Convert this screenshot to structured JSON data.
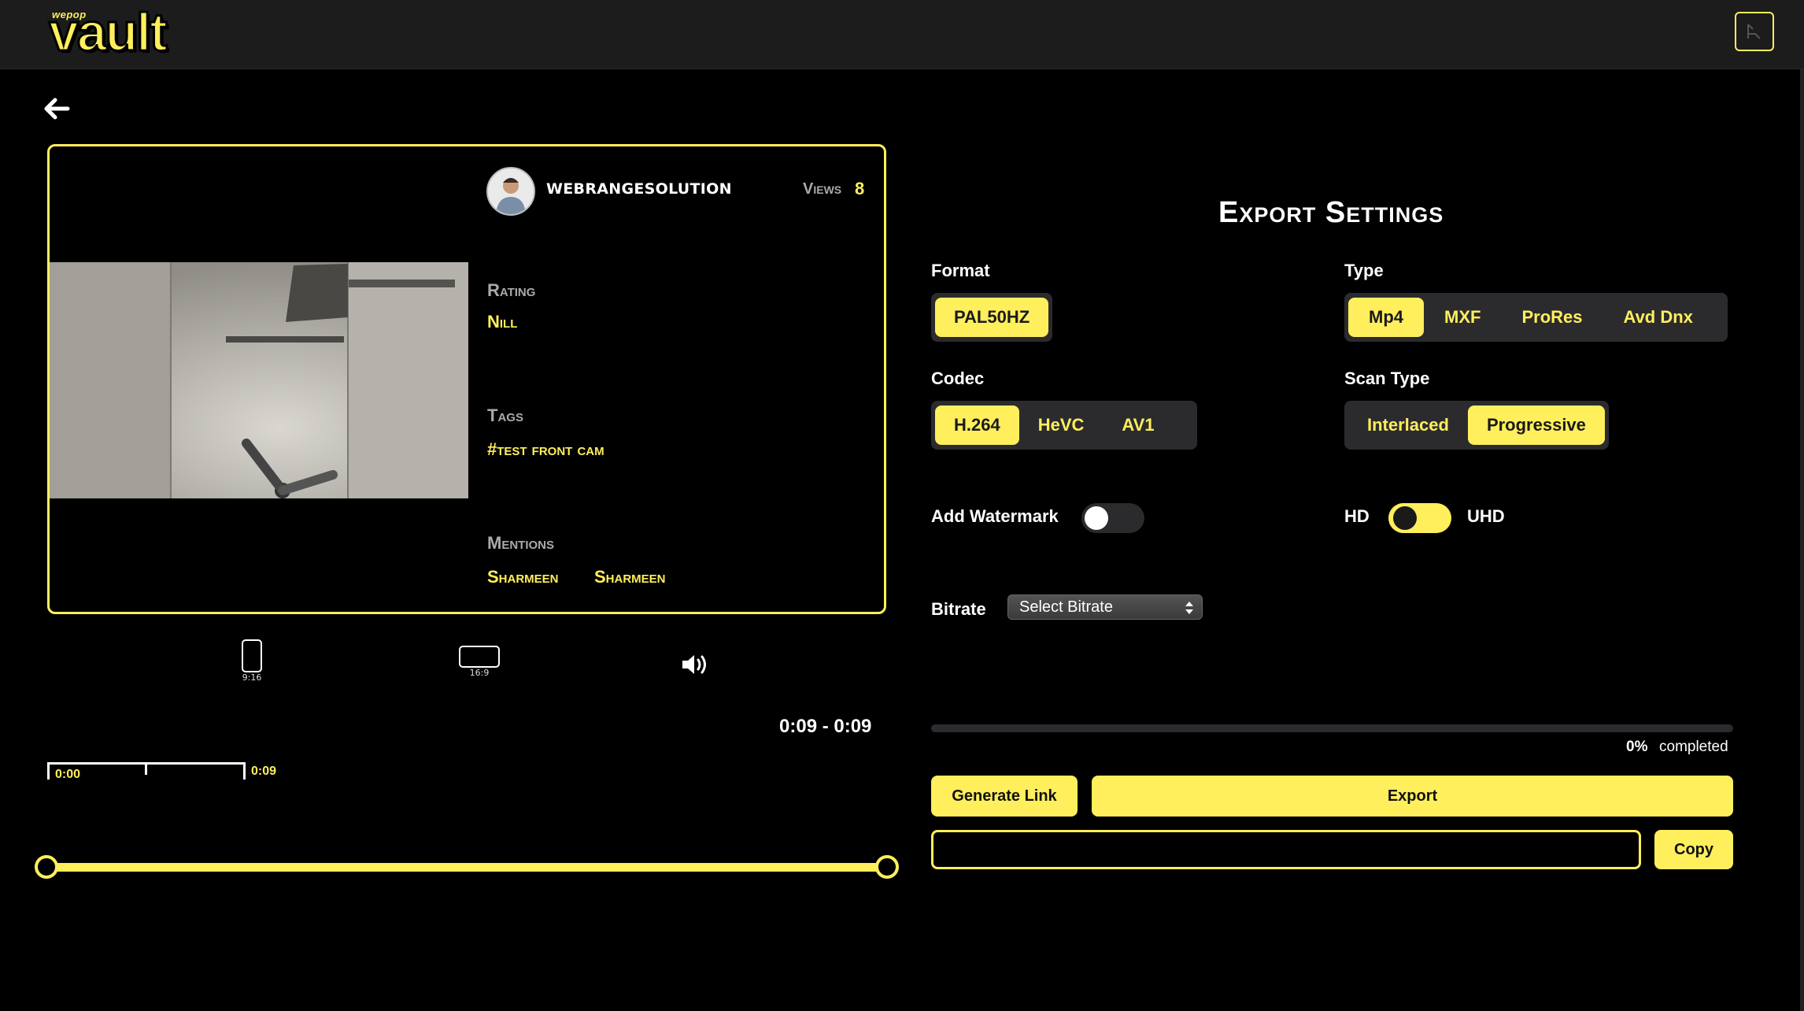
{
  "app": {
    "logo_small": "wepop",
    "logo": "vault"
  },
  "colors": {
    "accent": "#ffef5c",
    "panel": "#2b2b2e",
    "background": "#000000"
  },
  "video_card": {
    "username": "WEBRANGESOLUTION",
    "views_label": "Views",
    "views_value": "8",
    "rating_label": "Rating",
    "rating_value": "Nill",
    "tags_label": "Tags",
    "tags_value": "#test front cam",
    "mentions_label": "Mentions",
    "mentions": [
      "Sharmeen",
      "Sharmeen"
    ]
  },
  "player": {
    "aspect_portrait": "9:16",
    "aspect_landscape": "16:9",
    "volume_icon": "speaker-icon",
    "timecode": "0:09 - 0:09",
    "ruler_start": "0:00",
    "ruler_end": "0:09"
  },
  "export": {
    "title": "Export Settings",
    "format_label": "Format",
    "format_options": [
      "PAL50HZ"
    ],
    "format_selected": 0,
    "type_label": "Type",
    "type_options": [
      "Mp4",
      "MXF",
      "ProRes",
      "Avd Dnx"
    ],
    "type_selected": 0,
    "codec_label": "Codec",
    "codec_options": [
      "H.264",
      "HeVC",
      "AV1"
    ],
    "codec_selected": 0,
    "scan_label": "Scan Type",
    "scan_options": [
      "Interlaced",
      "Progressive"
    ],
    "scan_selected": 1,
    "watermark_label": "Add Watermark",
    "watermark_on": false,
    "hd_label": "HD",
    "uhd_label": "UHD",
    "uhd_on": false,
    "bitrate_label": "Bitrate",
    "bitrate_placeholder": "Select Bitrate",
    "progress_percent": 0,
    "progress_text": "0%",
    "progress_suffix": "completed",
    "generate_link_label": "Generate Link",
    "export_label": "Export",
    "link_value": "",
    "copy_label": "Copy"
  }
}
